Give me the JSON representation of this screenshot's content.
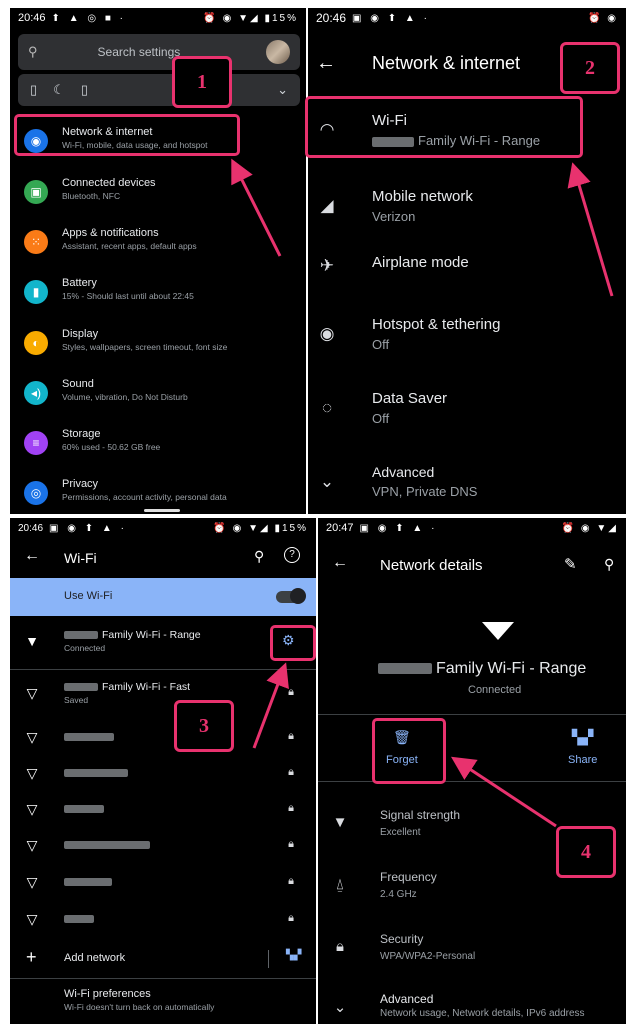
{
  "panel1": {
    "status": {
      "time": "20:46",
      "battery": "15%"
    },
    "search_placeholder": "Search settings",
    "items": [
      {
        "title": "Network & internet",
        "subtitle": "Wi-Fi, mobile, data usage, and hotspot",
        "icon": "wifi-icon",
        "color": "#1a73e8"
      },
      {
        "title": "Connected devices",
        "subtitle": "Bluetooth, NFC",
        "icon": "devices-icon",
        "color": "#34a853"
      },
      {
        "title": "Apps & notifications",
        "subtitle": "Assistant, recent apps, default apps",
        "icon": "apps-icon",
        "color": "#fa7b17"
      },
      {
        "title": "Battery",
        "subtitle": "15% - Should last until about 22:45",
        "icon": "battery-icon",
        "color": "#12b5cb"
      },
      {
        "title": "Display",
        "subtitle": "Styles, wallpapers, screen timeout, font size",
        "icon": "display-icon",
        "color": "#f9ab00"
      },
      {
        "title": "Sound",
        "subtitle": "Volume, vibration, Do Not Disturb",
        "icon": "sound-icon",
        "color": "#12b5cb"
      },
      {
        "title": "Storage",
        "subtitle": "60% used - 50.62 GB free",
        "icon": "storage-icon",
        "color": "#a142f4"
      },
      {
        "title": "Privacy",
        "subtitle": "Permissions, account activity, personal data",
        "icon": "privacy-icon",
        "color": "#1a73e8"
      }
    ]
  },
  "panel2": {
    "status": {
      "time": "20:46"
    },
    "title": "Network & internet",
    "items": [
      {
        "title": "Wi-Fi",
        "subtitle": "Family Wi-Fi - Range",
        "icon": "wifi-icon"
      },
      {
        "title": "Mobile network",
        "subtitle": "Verizon",
        "icon": "signal-icon"
      },
      {
        "title": "Airplane mode",
        "subtitle": "",
        "icon": "airplane-icon"
      },
      {
        "title": "Hotspot & tethering",
        "subtitle": "Off",
        "icon": "hotspot-icon"
      },
      {
        "title": "Data Saver",
        "subtitle": "Off",
        "icon": "data-saver-icon"
      },
      {
        "title": "Advanced",
        "subtitle": "VPN, Private DNS",
        "icon": "chevron-down-icon"
      }
    ]
  },
  "panel3": {
    "status": {
      "time": "20:46",
      "battery": "15%"
    },
    "title": "Wi-Fi",
    "use_wifi": "Use Wi-Fi",
    "networks": [
      {
        "name": "Family Wi-Fi - Range",
        "status": "Connected"
      },
      {
        "name": "Family Wi-Fi - Fast",
        "status": "Saved"
      },
      {
        "name": "",
        "status": ""
      },
      {
        "name": "",
        "status": ""
      },
      {
        "name": "",
        "status": ""
      },
      {
        "name": "",
        "status": ""
      },
      {
        "name": "",
        "status": ""
      },
      {
        "name": "",
        "status": ""
      }
    ],
    "add_network": "Add network",
    "prefs_title": "Wi-Fi preferences",
    "prefs_subtitle": "Wi-Fi doesn't turn back on automatically"
  },
  "panel4": {
    "status": {
      "time": "20:47"
    },
    "title": "Network details",
    "network_name": "Family Wi-Fi - Range",
    "network_status": "Connected",
    "forget": "Forget",
    "share": "Share",
    "details": [
      {
        "title": "Signal strength",
        "value": "Excellent",
        "icon": "wifi-icon"
      },
      {
        "title": "Frequency",
        "value": "2.4 GHz",
        "icon": "antenna-icon"
      },
      {
        "title": "Security",
        "value": "WPA/WPA2-Personal",
        "icon": "lock-icon"
      },
      {
        "title": "Advanced",
        "value": "Network usage, Network details, IPv6 address",
        "icon": "chevron-down-icon"
      }
    ]
  },
  "annotations": {
    "steps": [
      "1",
      "2",
      "3",
      "4"
    ],
    "color": "#e8326e"
  }
}
